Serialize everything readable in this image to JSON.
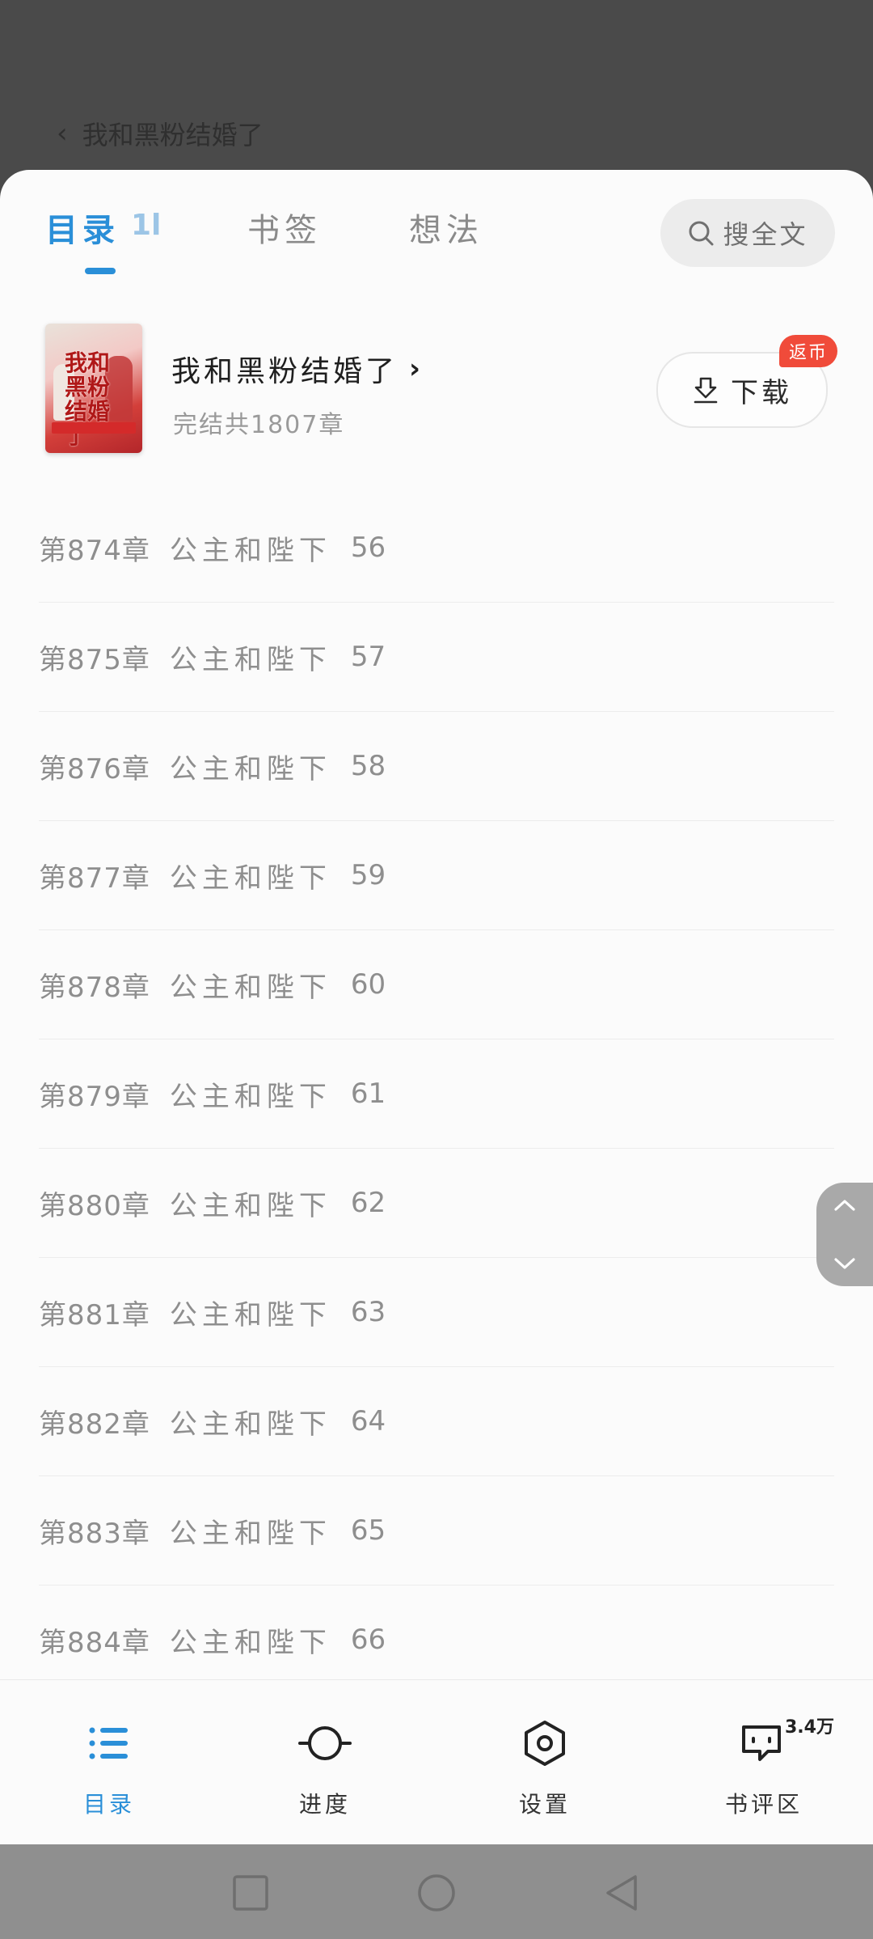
{
  "backdrop": {
    "back_icon": "chevron-left",
    "title": "我和黑粉结婚了"
  },
  "tabs": {
    "items": [
      {
        "label": "目录",
        "active": true
      },
      {
        "label": "书签",
        "active": false
      },
      {
        "label": "想法",
        "active": false
      }
    ],
    "sort_glyph": "1l",
    "search_label": "搜全文"
  },
  "book": {
    "cover_text": "我和黑粉结婚了",
    "title": "我和黑粉结婚了",
    "title_arrow": "›",
    "meta": "完结共1807章",
    "download_label": "下载",
    "badge": "返币"
  },
  "chapters": [
    {
      "num": "第874章",
      "title": "公主和陛下",
      "part": "56"
    },
    {
      "num": "第875章",
      "title": "公主和陛下",
      "part": "57"
    },
    {
      "num": "第876章",
      "title": "公主和陛下",
      "part": "58"
    },
    {
      "num": "第877章",
      "title": "公主和陛下",
      "part": "59"
    },
    {
      "num": "第878章",
      "title": "公主和陛下",
      "part": "60"
    },
    {
      "num": "第879章",
      "title": "公主和陛下",
      "part": "61"
    },
    {
      "num": "第880章",
      "title": "公主和陛下",
      "part": "62"
    },
    {
      "num": "第881章",
      "title": "公主和陛下",
      "part": "63"
    },
    {
      "num": "第882章",
      "title": "公主和陛下",
      "part": "64"
    },
    {
      "num": "第883章",
      "title": "公主和陛下",
      "part": "65"
    },
    {
      "num": "第884章",
      "title": "公主和陛下",
      "part": "66"
    }
  ],
  "bottom_nav": {
    "items": [
      {
        "label": "目录",
        "icon": "list-icon",
        "active": true
      },
      {
        "label": "进度",
        "icon": "progress-icon",
        "active": false
      },
      {
        "label": "设置",
        "icon": "settings-icon",
        "active": false
      },
      {
        "label": "书评区",
        "icon": "comments-icon",
        "active": false
      }
    ],
    "review_count": "3.4万"
  },
  "colors": {
    "accent": "#2a8fd8",
    "badge": "#f04b3a",
    "text_muted": "#8e8e8e"
  }
}
